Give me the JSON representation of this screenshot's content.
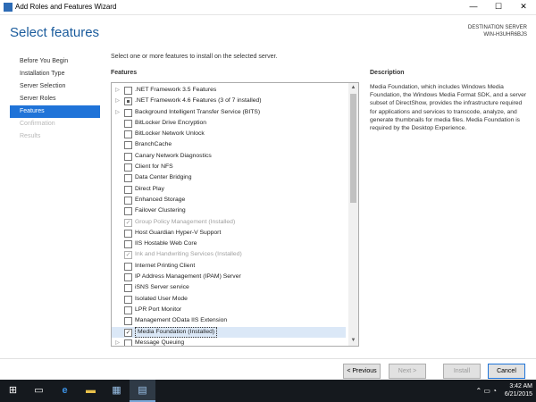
{
  "window": {
    "title": "Add Roles and Features Wizard",
    "minimize": "—",
    "maximize": "☐",
    "close": "✕"
  },
  "header": {
    "page_title": "Select features",
    "destination_label": "DESTINATION SERVER",
    "destination_server": "WIN-H3UHR6BJS"
  },
  "nav": {
    "items": [
      {
        "label": "Before You Begin",
        "state": "normal"
      },
      {
        "label": "Installation Type",
        "state": "normal"
      },
      {
        "label": "Server Selection",
        "state": "normal"
      },
      {
        "label": "Server Roles",
        "state": "normal"
      },
      {
        "label": "Features",
        "state": "active"
      },
      {
        "label": "Confirmation",
        "state": "disabled"
      },
      {
        "label": "Results",
        "state": "disabled"
      }
    ]
  },
  "content": {
    "instruction": "Select one or more features to install on the selected server.",
    "features_heading": "Features",
    "description_heading": "Description",
    "description_text": "Media Foundation, which includes Windows Media Foundation, the Windows Media Format SDK, and a server subset of DirectShow, provides the infrastructure required for applications and services to transcode, analyze, and generate thumbnails for media files. Media Foundation is required by the Desktop Experience."
  },
  "features": [
    {
      "label": ".NET Framework 3.5 Features",
      "expander": "▷",
      "check": "none"
    },
    {
      "label": ".NET Framework 4.6 Features (3 of 7 installed)",
      "expander": "▷",
      "check": "partial"
    },
    {
      "label": "Background Intelligent Transfer Service (BITS)",
      "expander": "▷",
      "check": "none"
    },
    {
      "label": "BitLocker Drive Encryption",
      "expander": "",
      "check": "none"
    },
    {
      "label": "BitLocker Network Unlock",
      "expander": "",
      "check": "none"
    },
    {
      "label": "BranchCache",
      "expander": "",
      "check": "none"
    },
    {
      "label": "Canary Network Diagnostics",
      "expander": "",
      "check": "none"
    },
    {
      "label": "Client for NFS",
      "expander": "",
      "check": "none"
    },
    {
      "label": "Data Center Bridging",
      "expander": "",
      "check": "none"
    },
    {
      "label": "Direct Play",
      "expander": "",
      "check": "none"
    },
    {
      "label": "Enhanced Storage",
      "expander": "",
      "check": "none"
    },
    {
      "label": "Failover Clustering",
      "expander": "",
      "check": "none"
    },
    {
      "label": "Group Policy Management (Installed)",
      "expander": "",
      "check": "installed"
    },
    {
      "label": "Host Guardian Hyper-V Support",
      "expander": "",
      "check": "none"
    },
    {
      "label": "IIS Hostable Web Core",
      "expander": "",
      "check": "none"
    },
    {
      "label": "Ink and Handwriting Services (Installed)",
      "expander": "",
      "check": "installed"
    },
    {
      "label": "Internet Printing Client",
      "expander": "",
      "check": "none"
    },
    {
      "label": "IP Address Management (IPAM) Server",
      "expander": "",
      "check": "none"
    },
    {
      "label": "iSNS Server service",
      "expander": "",
      "check": "none"
    },
    {
      "label": "Isolated User Mode",
      "expander": "",
      "check": "none"
    },
    {
      "label": "LPR Port Monitor",
      "expander": "",
      "check": "none"
    },
    {
      "label": "Management OData IIS Extension",
      "expander": "",
      "check": "none"
    },
    {
      "label": "Media Foundation (Installed)",
      "expander": "",
      "check": "checked",
      "selected": true
    },
    {
      "label": "Message Queuing",
      "expander": "▷",
      "check": "none"
    }
  ],
  "scrollbar": {
    "up": "▲",
    "down": "▼"
  },
  "buttons": {
    "previous": "< Previous",
    "next": "Next >",
    "install": "Install",
    "cancel": "Cancel"
  },
  "taskbar": {
    "start_icon": "windows-logo",
    "time": "3:42 AM",
    "date": "6/21/2015"
  },
  "colors": {
    "accent": "#1f73d8",
    "title": "#1a5b9c",
    "taskbar": "#15191e"
  }
}
